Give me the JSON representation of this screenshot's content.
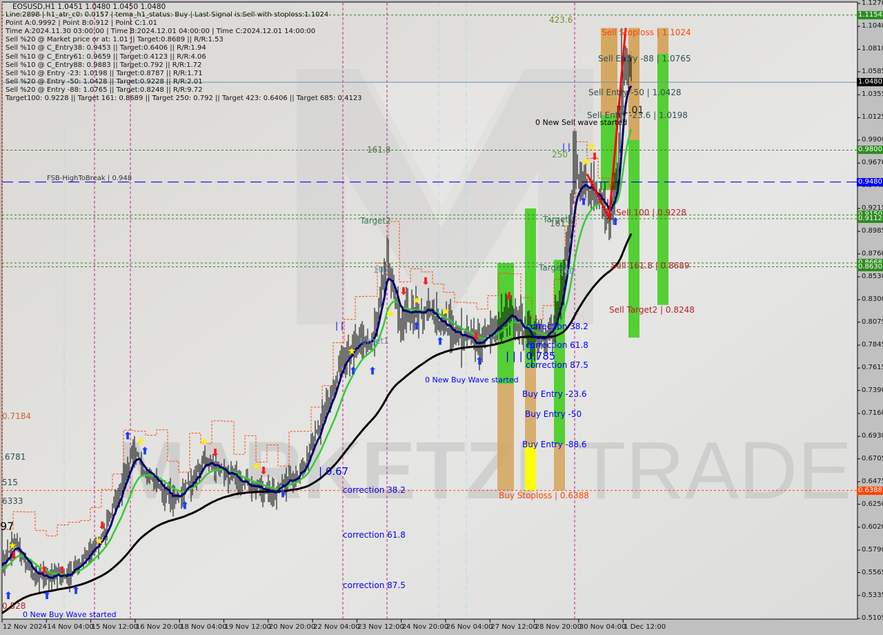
{
  "header": {
    "symbol_line": "EOSUSD,H1  1.0451 1.0480 1.0450 1.0480",
    "info_lines": [
      "Line:2898 | h1_atr_c0: 0.0157 | tema_h1_status: Buy | Last Signal is:Sell with stoploss:1.1024",
      "Point A:0.9992 | Point B:0.912 | Point C:1.01",
      "Time A:2024.11.30 03:00:00 | Time B:2024.12.01 04:00:00 | Time C:2024.12.01 14:00:00",
      "Sell %20 @ Market price or at: 1.01 || Target:0.8689 || R/R:1.53",
      "Sell %10 @ C_Entry38: 0.9453 || Target:0.6406 || R/R:1.94",
      "Sell %10 @ C_Entry61: 0.9659 || Target:0.4123 || R/R:4.06",
      "Sell %10 @ C_Entry88: 0.9883 || Target:0.792 || R/R:1.72",
      "Sell %10 @ Entry -23: 1.0198 || Target:0.8787 || R/R:1.71",
      "Sell %20 @ Entry -50: 1.0428 || Target:0.9228 || R/R:2.01",
      "Sell %20 @ Entry -88: 1.0765 || Target:0.8248 || R/R:9.72",
      "Target100: 0.9228 || Target 161: 0.8689 || Target 250: 0.792 || Target 423: 0.6406 || Target 685: 0.4123"
    ]
  },
  "chart_data": {
    "type": "ohlc-bar",
    "symbol": "EOSUSD",
    "timeframe": "H1",
    "ylim": [
      0.5105,
      1.127
    ],
    "y_ticks": [
      "1.1270",
      "1.1040",
      "1.0810",
      "1.0585",
      "1.0355",
      "1.0125",
      "0.9900",
      "0.9670",
      "0.9445",
      "0.9215",
      "0.8985",
      "0.8760",
      "0.8530",
      "0.8300",
      "0.8075",
      "0.7845",
      "0.7615",
      "0.7390",
      "0.7160",
      "0.6930",
      "0.6705",
      "0.6475",
      "0.6250",
      "0.6020",
      "0.5790",
      "0.5565",
      "0.5335",
      "0.5105"
    ],
    "x_ticks": [
      "12 Nov 2024",
      "14 Nov 04:00",
      "15 Nov 12:00",
      "16 Nov 20:00",
      "18 Nov 04:00",
      "19 Nov 12:00",
      "20 Nov 20:00",
      "22 Nov 04:00",
      "23 Nov 12:00",
      "24 Nov 20:00",
      "26 Nov 04:00",
      "27 Nov 12:00",
      "28 Nov 20:00",
      "30 Nov 04:00",
      "1 Dec 12:00"
    ],
    "x_start": "2024-11-12T20:00",
    "approx_close_path": [
      {
        "t": "2024-11-12T20:00",
        "p": 0.565
      },
      {
        "t": "2024-11-13T05:00",
        "p": 0.585
      },
      {
        "t": "2024-11-13T20:00",
        "p": 0.55
      },
      {
        "t": "2024-11-14T20:00",
        "p": 0.555
      },
      {
        "t": "2024-11-15T20:00",
        "p": 0.59
      },
      {
        "t": "2024-11-16T18:00",
        "p": 0.675
      },
      {
        "t": "2024-11-18T00:00",
        "p": 0.628
      },
      {
        "t": "2024-11-19T01:00",
        "p": 0.668
      },
      {
        "t": "2024-11-20T02:00",
        "p": 0.645
      },
      {
        "t": "2024-11-21T03:00",
        "p": 0.637
      },
      {
        "t": "2024-11-21T23:00",
        "p": 0.665
      },
      {
        "t": "2024-11-22T14:00",
        "p": 0.72
      },
      {
        "t": "2024-11-23T05:00",
        "p": 0.78
      },
      {
        "t": "2024-11-24T01:00",
        "p": 0.79
      },
      {
        "t": "2024-11-24T11:00",
        "p": 0.87
      },
      {
        "t": "2024-11-24T19:00",
        "p": 0.812
      },
      {
        "t": "2024-11-25T17:00",
        "p": 0.82
      },
      {
        "t": "2024-11-26T08:00",
        "p": 0.8
      },
      {
        "t": "2024-11-27T04:00",
        "p": 0.785
      },
      {
        "t": "2024-11-28T05:00",
        "p": 0.815
      },
      {
        "t": "2024-11-28T20:00",
        "p": 0.79
      },
      {
        "t": "2024-11-29T11:00",
        "p": 0.8
      },
      {
        "t": "2024-11-29T18:00",
        "p": 0.84
      },
      {
        "t": "2024-11-30T03:00",
        "p": 0.96
      },
      {
        "t": "2024-11-30T13:00",
        "p": 0.945
      },
      {
        "t": "2024-12-01T04:00",
        "p": 0.915
      },
      {
        "t": "2024-12-01T10:00",
        "p": 0.95
      },
      {
        "t": "2024-12-01T14:00",
        "p": 1.07
      },
      {
        "t": "2024-12-01T20:00",
        "p": 1.048
      }
    ],
    "zigzag": [
      {
        "t": "2024-11-30T12:00",
        "p": 0.956
      },
      {
        "t": "2024-12-01T04:00",
        "p": 0.912
      },
      {
        "t": "2024-12-01T16:00",
        "p": 1.1024
      }
    ],
    "last_price": "1.0480",
    "price_badges": [
      {
        "value": "1.1154",
        "color": "#2e8b22",
        "line": "dotted-green"
      },
      {
        "value": "1.0480",
        "color": "#000000",
        "line": "solid-steel"
      },
      {
        "value": "0.9800",
        "color": "#2e8b22",
        "line": "dotted-green"
      },
      {
        "value": "0.9480",
        "color": "#0000ff",
        "line": "dashed-blue"
      },
      {
        "value": "0.9150",
        "color": "#2e8b22",
        "line": "dotted-green"
      },
      {
        "value": "0.9112",
        "color": "#2e8b22",
        "line": "dotted-green"
      },
      {
        "value": "0.8668",
        "color": "#2e8b22",
        "line": "dotted-green"
      },
      {
        "value": "0.8630",
        "color": "#2e8b22",
        "line": "dotted-green"
      },
      {
        "value": "0.6388",
        "color": "#ff4500",
        "line": "dotted-orange"
      }
    ],
    "zones": [
      {
        "side": "buy",
        "green": [
          0.8668,
          0.7455
        ],
        "tan": [
          0.7455,
          0.6388
        ]
      },
      {
        "side": "buy",
        "green": [
          0.9215,
          0.7615
        ],
        "tan": [
          0.7615,
          0.685
        ],
        "yellow": [
          0.685,
          0.6388
        ]
      },
      {
        "side": "buy",
        "green": [
          0.87,
          0.685
        ],
        "tan": [
          0.685,
          0.6388
        ]
      },
      {
        "side": "sell",
        "tan": [
          1.1024,
          1.015
        ],
        "green": [
          1.015,
          0.94
        ]
      },
      {
        "side": "sell",
        "tan": [
          1.1024,
          0.99
        ],
        "green": [
          0.99,
          0.792
        ]
      },
      {
        "side": "sell",
        "tan": [
          1.1024,
          1.0765
        ],
        "green": [
          1.0765,
          0.8248
        ]
      }
    ],
    "colors": {
      "ma_long": "#000000",
      "ma_mid": "#33cc33",
      "ma_fast": "#00006e",
      "zigzag": "#ff0000",
      "buy_zone": "#4ccf2a",
      "sell_zone": "#d4a45a",
      "yellow_zone": "#ffff00"
    }
  },
  "annotations": {
    "fib_423": "423.6",
    "fib_161_left": "161.8",
    "target2_left": "Target2",
    "fib_100_left": "100",
    "target1_left": "Target1",
    "fib_250": "250",
    "target2_right": "Target2",
    "fib_161_right": "161.8",
    "target1_right": "Target1",
    "fib_100_right": "100",
    "fsb": "FSB-HighToBreak  | 0.948",
    "sell_stoploss": "Sell Stoploss | 1.1024",
    "sell_entry_88": "Sell Entry -88 | 1.0765",
    "sell_entry_50": "Sell Entry -50 | 1.0428",
    "sell_entry_23": "Sell Entry -23.6 | 1.0198",
    "sell_wave": "0 New Sell wave started",
    "point_c": "| 1.01",
    "sell_100": "Sell 100 | 0.9228",
    "sell_161": "Sell 161.8 | 0.8689",
    "sell_target2": "Sell Target2 | 0.8248",
    "bars_785": "| | | 0.785",
    "corr382_r": "correction 38.2",
    "corr618_r": "correction 61.8",
    "corr875_r": "correction 87.5",
    "buy_wave_r": "0 New Buy Wave started",
    "buy_entry_23": "Buy Entry -23.6",
    "buy_entry_50": "Buy Entry -50",
    "buy_entry_88": "Buy Entry -88.6",
    "buy_stoploss": "Buy Stoploss | 0.6388",
    "bars_067": "| 0.67",
    "corr382_l": "correction 38.2",
    "corr618_l": "correction 61.8",
    "corr875_l": "correction 87.5",
    "buy_wave_l": "0 New Buy Wave started",
    "bars_mid": "|  |",
    "bars_top": "|  |",
    "left_7184": "0.7184",
    "left_6781": ".6781",
    "left_515": "515",
    "left_6333": "6333",
    "left_97": "97",
    "left_528": "0.528"
  },
  "watermark": {
    "text_left": "MARKETZI",
    "text_right": "TRADE"
  }
}
